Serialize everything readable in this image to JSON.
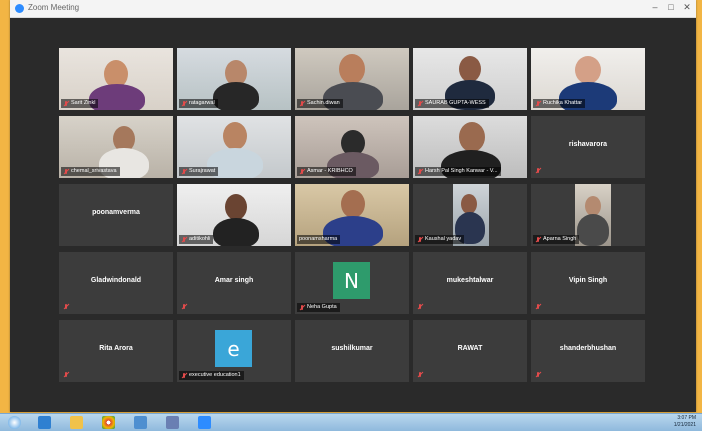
{
  "window": {
    "title": "Zoom Meeting"
  },
  "participants": [
    {
      "name": "Sarit Zinkl",
      "video": true
    },
    {
      "name": "ratagarwal",
      "video": true
    },
    {
      "name": "Sachin.diwan",
      "video": true
    },
    {
      "name": "SAURAB GUPTA-WESS",
      "video": true
    },
    {
      "name": "Ruchika Khattar",
      "video": true
    },
    {
      "name": "chemal_srivastava",
      "video": true
    },
    {
      "name": "Surajrawat",
      "video": true
    },
    {
      "name": "Asmar - KRIBHCO",
      "video": true
    },
    {
      "name": "Harsh Pal Singh Kanwar - V...",
      "video": true
    },
    {
      "name": "rishavarora",
      "video": false
    },
    {
      "name": "poonamverma",
      "video": false
    },
    {
      "name": "aditikohli",
      "video": true
    },
    {
      "name": "poonamsharma",
      "video": true
    },
    {
      "name": "Kaushal yadav",
      "video": true
    },
    {
      "name": "Aparna Singh",
      "video": true
    },
    {
      "name": "Gladwindonald",
      "video": false
    },
    {
      "name": "Amar singh",
      "video": false
    },
    {
      "name": "Neha Gupta",
      "video": false,
      "avatar": "N"
    },
    {
      "name": "mukeshtalwar",
      "video": false
    },
    {
      "name": "Vipin Singh",
      "video": false
    },
    {
      "name": "Rita Arora",
      "video": false
    },
    {
      "name": "executive education1",
      "video": false,
      "avatar": "e"
    },
    {
      "name": "sushilkumar",
      "video": false
    },
    {
      "name": "RAWAT",
      "video": false
    },
    {
      "name": "shanderbhushan",
      "video": false
    }
  ],
  "avatar_colors": {
    "N": "#2e9b6c",
    "e": "#3aa6d8"
  },
  "active_speaker": "poonamsharma",
  "taskbar": {
    "clock_time": "3:07 PM",
    "clock_date": "1/21/2021"
  }
}
